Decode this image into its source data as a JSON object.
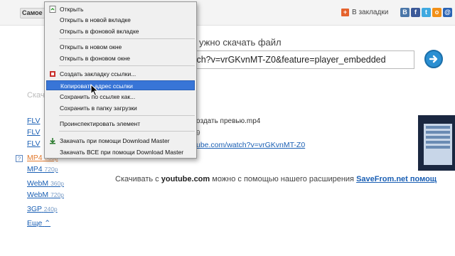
{
  "topbar": {
    "tab_label": "Самое",
    "bookmarks_label": "В закладки",
    "social": [
      {
        "name": "vk",
        "glyph": "B",
        "color": "#4a76a8"
      },
      {
        "name": "facebook",
        "glyph": "f",
        "color": "#3b5998"
      },
      {
        "name": "twitter",
        "glyph": "t",
        "color": "#3fa9e0"
      },
      {
        "name": "odnoklassniki",
        "glyph": "o",
        "color": "#f29018"
      },
      {
        "name": "mailru",
        "glyph": "@",
        "color": "#2a63b4"
      }
    ]
  },
  "main": {
    "heading": "ужно скачать файл",
    "url_value": "tch?v=vrGKvnMT-Z0&feature=player_embedded",
    "section_label": "Скач",
    "formats": [
      {
        "name": "FLV",
        "quality": ""
      },
      {
        "name": "FLV",
        "quality": ""
      },
      {
        "name": "FLV",
        "quality": ""
      },
      {
        "name": "MP4",
        "quality": "360p"
      },
      {
        "name": "MP4",
        "quality": "720p"
      },
      {
        "name": "WebM",
        "quality": "360p"
      },
      {
        "name": "WebM",
        "quality": "720p"
      },
      {
        "name": "3GP",
        "quality": "240p"
      }
    ],
    "help_glyph": "?",
    "more_label": "Еще",
    "more_icon": "double-chevron-up-icon",
    "file_name": "оздать превью.mp4",
    "file_meta": "9",
    "source_link": "ube.com/watch?v=vrGKvnMT-Z0",
    "promo_prefix": "Скачивать с",
    "promo_site": "youtube.com",
    "promo_middle": "можно с помощью нашего расширения",
    "promo_link": "SaveFrom.net помощ"
  },
  "context_menu": {
    "items": [
      {
        "label": "Открыть",
        "icon": "open-page-icon"
      },
      {
        "label": "Открыть в новой вкладке"
      },
      {
        "label": "Открыть в фоновой вкладке"
      },
      {
        "label": "Открыть в новом окне"
      },
      {
        "label": "Открыть в фоновом окне"
      },
      {
        "label": "Создать закладку ссылки...",
        "icon": "bookmark-icon"
      },
      {
        "label": "Копировать адрес ссылки",
        "highlighted": true
      },
      {
        "label": "Сохранить по ссылке как..."
      },
      {
        "label": "Сохранить в папку загрузки"
      },
      {
        "label": "Проинспектировать элемент"
      },
      {
        "label": "Закачать при помощи Download Master",
        "icon": "download-master-icon"
      },
      {
        "label": "Закачать ВСЕ при помощи Download Master"
      }
    ]
  },
  "colors": {
    "accent": "#3875d7",
    "link": "#1a5fb4",
    "selected_format": "#e2792d"
  }
}
